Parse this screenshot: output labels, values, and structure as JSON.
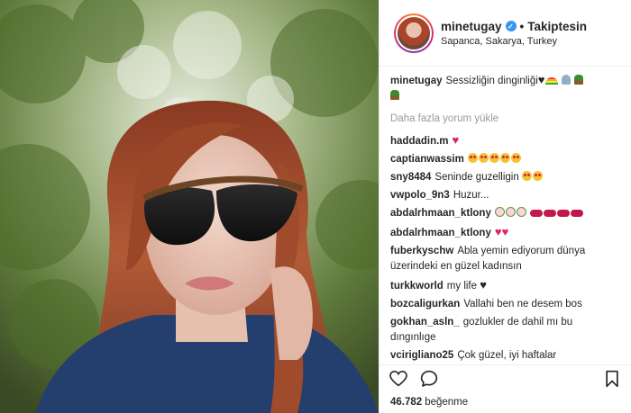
{
  "post": {
    "username": "minetugay",
    "follow_status": "Takiptesin",
    "location": "Sapanca, Sakarya, Turkey",
    "caption_user": "minetugay",
    "caption_text": "Sessizliğin dinginliği",
    "caption_emojis": [
      "black-heart",
      "rainbow",
      "praying-hands",
      "potted-plant",
      "bouquet"
    ],
    "load_more_label": "Daha fazla yorum yükle",
    "likes_count": "46.782",
    "likes_label": "beğenme"
  },
  "comments": [
    {
      "user": "haddadin.m",
      "text": "",
      "emojis": [
        "red-heart"
      ]
    },
    {
      "user": "captianwassim",
      "text": "",
      "emojis": [
        "heart-eyes",
        "heart-eyes",
        "heart-eyes",
        "heart-eyes",
        "heart-eyes"
      ]
    },
    {
      "user": "sny8484",
      "text": "Seninde guzelligin",
      "emojis": [
        "heart-eyes",
        "heart-eyes"
      ]
    },
    {
      "user": "vwpolo_9n3",
      "text": "Huzur...",
      "emojis": []
    },
    {
      "user": "abdalrhmaan_ktlony",
      "text": "",
      "emojis": [
        "rose",
        "rose",
        "rose",
        "lips",
        "lips",
        "lips",
        "lips"
      ]
    },
    {
      "user": "abdalrhmaan_ktlony",
      "text": "",
      "emojis": [
        "red-heart",
        "red-heart"
      ]
    },
    {
      "user": "fuberkyschw",
      "text": "Abla yemin ediyorum dünya üzerindeki en güzel kadınsın",
      "emojis": []
    },
    {
      "user": "turkkworld",
      "text": "my life",
      "emojis": [
        "black-heart"
      ]
    },
    {
      "user": "bozcaligurkan",
      "text": "Vallahi ben ne desem bos",
      "emojis": []
    },
    {
      "user": "gokhan_asln_",
      "text": "gozlukler de dahil mı bu dıngınlıge",
      "emojis": []
    },
    {
      "user": "vcirigliano25",
      "text": "Çok güzel, iyi haftalar",
      "emojis": []
    }
  ],
  "icons": {
    "verified": "verified-badge-icon",
    "like": "heart-outline-icon",
    "comment": "comment-icon",
    "bookmark": "bookmark-icon"
  },
  "colors": {
    "verified": "#3897f0",
    "muted_text": "#999999",
    "text": "#262626",
    "heart": "#e0245e"
  }
}
